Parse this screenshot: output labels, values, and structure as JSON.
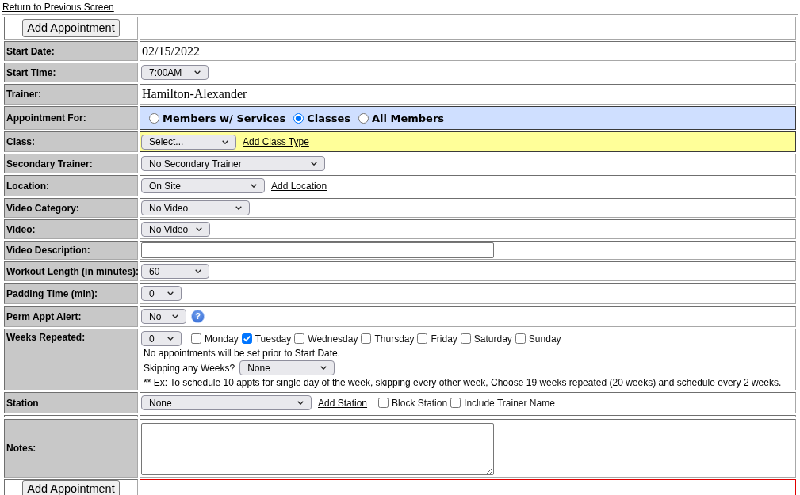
{
  "back_link": "Return to Previous Screen",
  "rows": [
    {
      "kind": "button",
      "button": "Add Appointment",
      "alert": false
    },
    {
      "kind": "field",
      "label": "Start Date:",
      "lines": [
        [
          {
            "kind": "value",
            "text": "02/15/2022"
          }
        ]
      ]
    },
    {
      "kind": "field",
      "label": "Start Time:",
      "lines": [
        [
          {
            "kind": "select",
            "value": "7:00AM"
          }
        ]
      ]
    },
    {
      "kind": "field",
      "label": "Trainer:",
      "lines": [
        [
          {
            "kind": "value",
            "text": "Hamilton-Alexander"
          }
        ]
      ]
    },
    {
      "kind": "field",
      "label": "Appointment For:",
      "color": "#cfdfff",
      "lines": [
        [
          {
            "kind": "radio",
            "label": "Members w/ Services",
            "selected": false
          },
          {
            "kind": "radio",
            "label": "Classes",
            "selected": true
          },
          {
            "kind": "radio",
            "label": "All Members",
            "selected": false
          }
        ]
      ]
    },
    {
      "kind": "field",
      "label": "Class:",
      "color": "#ffff99",
      "lines": [
        [
          {
            "kind": "select",
            "value": "Select..."
          },
          {
            "kind": "link",
            "text": "Add Class Type"
          }
        ]
      ]
    },
    {
      "kind": "field",
      "label": "Secondary Trainer:",
      "lines": [
        [
          {
            "kind": "select",
            "value": "No Secondary Trainer"
          }
        ]
      ]
    },
    {
      "kind": "field",
      "label": "Location:",
      "lines": [
        [
          {
            "kind": "select",
            "value": "On Site"
          },
          {
            "kind": "link",
            "text": "Add Location"
          }
        ]
      ]
    },
    {
      "kind": "field",
      "label": "Video Category:",
      "lines": [
        [
          {
            "kind": "select",
            "value": "No Video"
          }
        ]
      ]
    },
    {
      "kind": "field",
      "label": "Video:",
      "lines": [
        [
          {
            "kind": "select",
            "value": "No Video"
          }
        ]
      ]
    },
    {
      "kind": "field",
      "label": "Video Description:",
      "lines": [
        [
          {
            "kind": "input"
          }
        ]
      ]
    },
    {
      "kind": "field",
      "label": "Workout Length (in minutes):",
      "lines": [
        [
          {
            "kind": "select",
            "value": "60"
          }
        ]
      ]
    },
    {
      "kind": "field",
      "label": "Padding Time (min):",
      "lines": [
        [
          {
            "kind": "select",
            "value": "0"
          }
        ]
      ]
    },
    {
      "kind": "field",
      "label": "Perm Appt Alert:",
      "lines": [
        [
          {
            "kind": "select",
            "value": "No"
          },
          {
            "kind": "help",
            "text": "?"
          }
        ]
      ]
    },
    {
      "kind": "field",
      "label": "Weeks Repeated:",
      "lines": [
        [
          {
            "kind": "select",
            "value": "0"
          },
          {
            "kind": "checkbox",
            "label": "Monday",
            "checked": false
          },
          {
            "kind": "checkbox",
            "label": "Tuesday",
            "checked": true
          },
          {
            "kind": "checkbox",
            "label": "Wednesday",
            "checked": false
          },
          {
            "kind": "checkbox",
            "label": "Thursday",
            "checked": false
          },
          {
            "kind": "checkbox",
            "label": "Friday",
            "checked": false
          },
          {
            "kind": "checkbox",
            "label": "Saturday",
            "checked": false
          },
          {
            "kind": "checkbox",
            "label": "Sunday",
            "checked": false
          }
        ],
        [
          {
            "kind": "note",
            "text": "No appointments will be set prior to Start Date."
          }
        ],
        [
          {
            "kind": "label",
            "text": "Skipping any Weeks?"
          },
          {
            "kind": "select",
            "value": "None"
          }
        ],
        [
          {
            "kind": "note",
            "text": "** Ex: To schedule 10 appts for single day of the week, skipping every other week, Choose 19 weeks repeated (20 weeks) and schedule every 2 weeks."
          }
        ]
      ]
    },
    {
      "kind": "field",
      "label": "Station",
      "lines": [
        [
          {
            "kind": "select",
            "value": "None"
          },
          {
            "kind": "link",
            "text": "Add Station"
          },
          {
            "kind": "checkbox",
            "label": "Block Station",
            "checked": false
          },
          {
            "kind": "checkbox",
            "label": "Include Trainer Name",
            "checked": false
          }
        ]
      ]
    },
    {
      "kind": "spacer"
    },
    {
      "kind": "field",
      "label": "Notes:",
      "lines": [
        [
          {
            "kind": "textarea"
          }
        ]
      ]
    },
    {
      "kind": "button",
      "button": "Add Appointment",
      "alert": true
    }
  ]
}
